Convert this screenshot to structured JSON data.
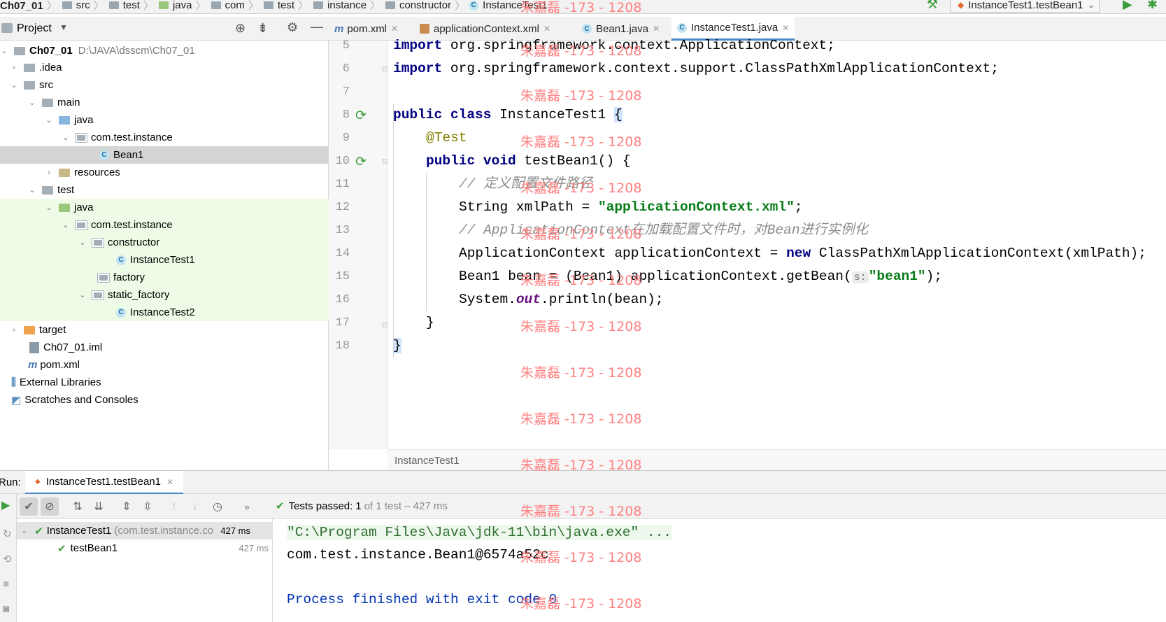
{
  "breadcrumb": [
    "Ch07_01",
    "src",
    "test",
    "java",
    "com",
    "test",
    "instance",
    "constructor",
    "InstanceTest1"
  ],
  "run_config": "InstanceTest1.testBean1",
  "project_panel": {
    "title": "Project"
  },
  "editor_tabs": [
    {
      "label": "pom.xml",
      "icon": "maven-icon"
    },
    {
      "label": "applicationContext.xml",
      "icon": "xml-icon"
    },
    {
      "label": "Bean1.java",
      "icon": "class-icon"
    },
    {
      "label": "InstanceTest1.java",
      "icon": "test-class-icon",
      "active": true
    }
  ],
  "tree": [
    {
      "label": "Ch07_01",
      "path": "D:\\JAVA\\dsscm\\Ch07_01",
      "icon": "module-folder"
    },
    {
      "label": ".idea",
      "icon": "folder"
    },
    {
      "label": "src",
      "icon": "folder"
    },
    {
      "label": "main",
      "icon": "folder"
    },
    {
      "label": "java",
      "icon": "source-folder"
    },
    {
      "label": "com.test.instance",
      "icon": "package"
    },
    {
      "label": "Bean1",
      "icon": "class",
      "selected": true
    },
    {
      "label": "resources",
      "icon": "resource-folder"
    },
    {
      "label": "test",
      "icon": "folder"
    },
    {
      "label": "java",
      "icon": "test-folder"
    },
    {
      "label": "com.test.instance",
      "icon": "package"
    },
    {
      "label": "constructor",
      "icon": "package"
    },
    {
      "label": "InstanceTest1",
      "icon": "test-class"
    },
    {
      "label": "factory",
      "icon": "package"
    },
    {
      "label": "static_factory",
      "icon": "package"
    },
    {
      "label": "InstanceTest2",
      "icon": "class"
    },
    {
      "label": "target",
      "icon": "excluded-folder"
    },
    {
      "label": "Ch07_01.iml",
      "icon": "iml-file"
    },
    {
      "label": "pom.xml",
      "icon": "maven-icon"
    },
    {
      "label": "External Libraries",
      "icon": "libraries-icon"
    },
    {
      "label": "Scratches and Consoles",
      "icon": "scratches-icon"
    }
  ],
  "code": {
    "line_numbers": [
      "5",
      "6",
      "7",
      "8",
      "9",
      "10",
      "11",
      "12",
      "13",
      "14",
      "15",
      "16",
      "17",
      "18"
    ],
    "l5_kw": "import",
    "l5_rest": " org.springframework.context.ApplicationContext;",
    "l6_kw": "import",
    "l6_rest": " org.springframework.context.support.ClassPathXmlApplicationContext;",
    "l8_kw": "public class",
    "l8_rest": " InstanceTest1 ",
    "l8_brace": "{",
    "l9_ann": "@Test",
    "l10_kw": "public void",
    "l10_rest": " testBean1() {",
    "l11_cmt": "// 定义配置文件路径",
    "l12_pre": "String xmlPath = ",
    "l12_str": "\"applicationContext.xml\"",
    "l12_post": ";",
    "l13_cmt": "// ApplicationContext在加载配置文件时，对Bean进行实例化",
    "l14_pre": "ApplicationContext applicationContext = ",
    "l14_kw": "new",
    "l14_post": " ClassPathXmlApplicationContext(xmlPath);",
    "l15_pre": "Bean1 bean = (Bean1) applicationContext.getBean(",
    "l15_hint": "s:",
    "l15_str": "\"bean1\"",
    "l15_post": ");",
    "l16_pre": "System.",
    "l16_fld": "out",
    "l16_post": ".println(bean);",
    "l17": "}",
    "l18": "}"
  },
  "editor_breadcrumb": "InstanceTest1",
  "run": {
    "label": "Run:",
    "tab": "InstanceTest1.testBean1",
    "status_prefix": "Tests passed:",
    "status_count": "1",
    "status_rest": "of 1 test – 427 ms",
    "tests": [
      {
        "name": "InstanceTest1",
        "detail": "(com.test.instance.co",
        "time": "427 ms"
      },
      {
        "name": "testBean1",
        "detail": "",
        "time": "427 ms"
      }
    ],
    "console": [
      "\"C:\\Program Files\\Java\\jdk-11\\bin\\java.exe\" ...",
      "com.test.instance.Bean1@6574a52c",
      "",
      "Process finished with exit code 0"
    ]
  },
  "watermark": "朱嘉磊 -173 - 1208"
}
